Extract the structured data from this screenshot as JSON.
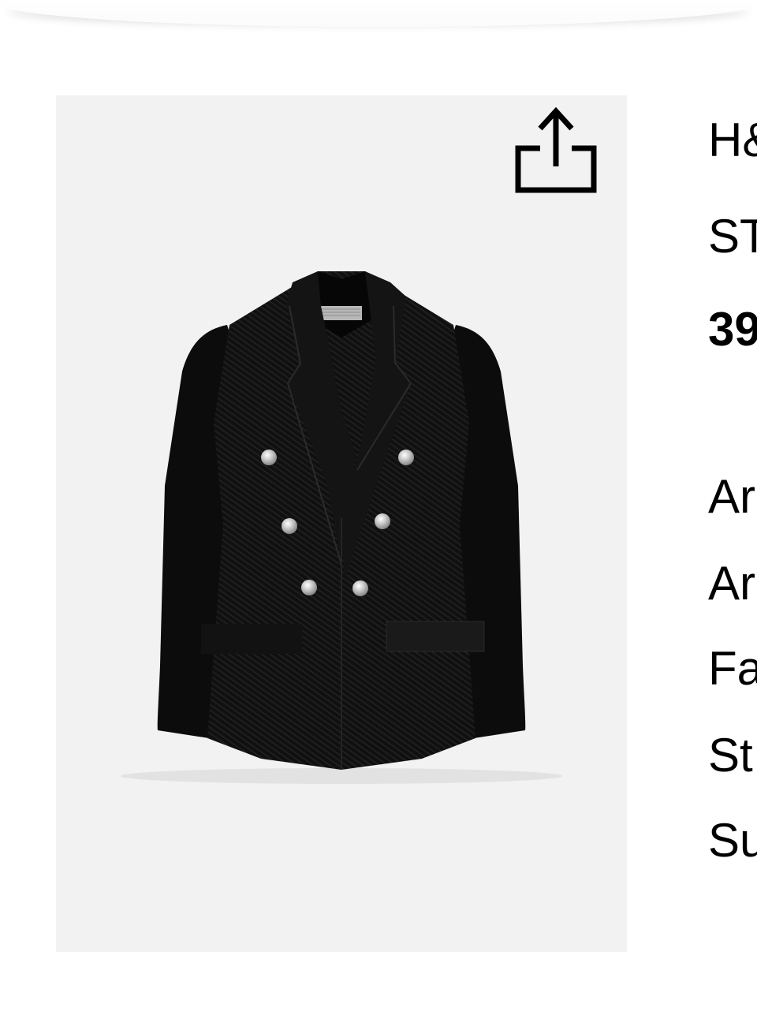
{
  "page": {
    "product_image_alt": "Black double-breasted tweed blazer",
    "share_icon": "share-icon"
  },
  "product": {
    "brand": "H&M",
    "name": "ST",
    "price": "39"
  },
  "links": [
    {
      "label": "Ar"
    },
    {
      "label": "Ar"
    },
    {
      "label": "Fa"
    },
    {
      "label": "St"
    },
    {
      "label": "Su"
    }
  ]
}
